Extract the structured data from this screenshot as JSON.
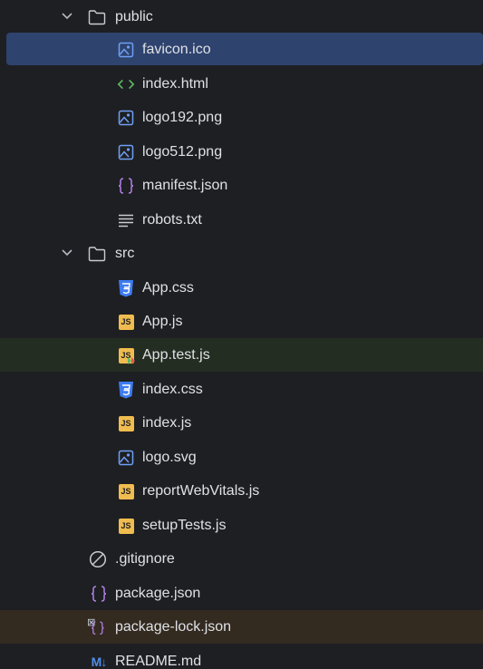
{
  "tree": {
    "public": {
      "label": "public",
      "icon": "folder-icon",
      "expanded": true
    },
    "public_files": [
      {
        "label": "favicon.ico",
        "icon": "image-file-icon"
      },
      {
        "label": "index.html",
        "icon": "html-code-icon"
      },
      {
        "label": "logo192.png",
        "icon": "image-file-icon"
      },
      {
        "label": "logo512.png",
        "icon": "image-file-icon"
      },
      {
        "label": "manifest.json",
        "icon": "json-braces-icon"
      },
      {
        "label": "robots.txt",
        "icon": "text-lines-icon"
      }
    ],
    "src": {
      "label": "src",
      "icon": "folder-icon",
      "expanded": true
    },
    "src_files": [
      {
        "label": "App.css",
        "icon": "css-shield-icon"
      },
      {
        "label": "App.js",
        "icon": "js-badge-icon"
      },
      {
        "label": "App.test.js",
        "icon": "js-test-badge-icon"
      },
      {
        "label": "index.css",
        "icon": "css-shield-icon"
      },
      {
        "label": "index.js",
        "icon": "js-badge-icon"
      },
      {
        "label": "logo.svg",
        "icon": "image-file-icon"
      },
      {
        "label": "reportWebVitals.js",
        "icon": "js-badge-icon"
      },
      {
        "label": "setupTests.js",
        "icon": "js-badge-icon"
      }
    ],
    "root_files": [
      {
        "label": ".gitignore",
        "icon": "ignore-icon"
      },
      {
        "label": "package.json",
        "icon": "json-braces-icon"
      },
      {
        "label": "package-lock.json",
        "icon": "json-locked-icon"
      },
      {
        "label": "README.md",
        "icon": "markdown-icon"
      }
    ],
    "js_badge_text": "JS",
    "markdown_badge_text": "M↓"
  },
  "colors": {
    "background": "#1e1f22",
    "selected_row": "#2e436e",
    "test_row": "#242d22",
    "locked_row": "#332a20",
    "text": "#dfe1e5",
    "image_icon": "#6f9ff5",
    "html_icon": "#5fb865",
    "json_icon": "#b281eb",
    "css_icon": "#3d7cf0",
    "js_icon": "#f0bc4f"
  }
}
